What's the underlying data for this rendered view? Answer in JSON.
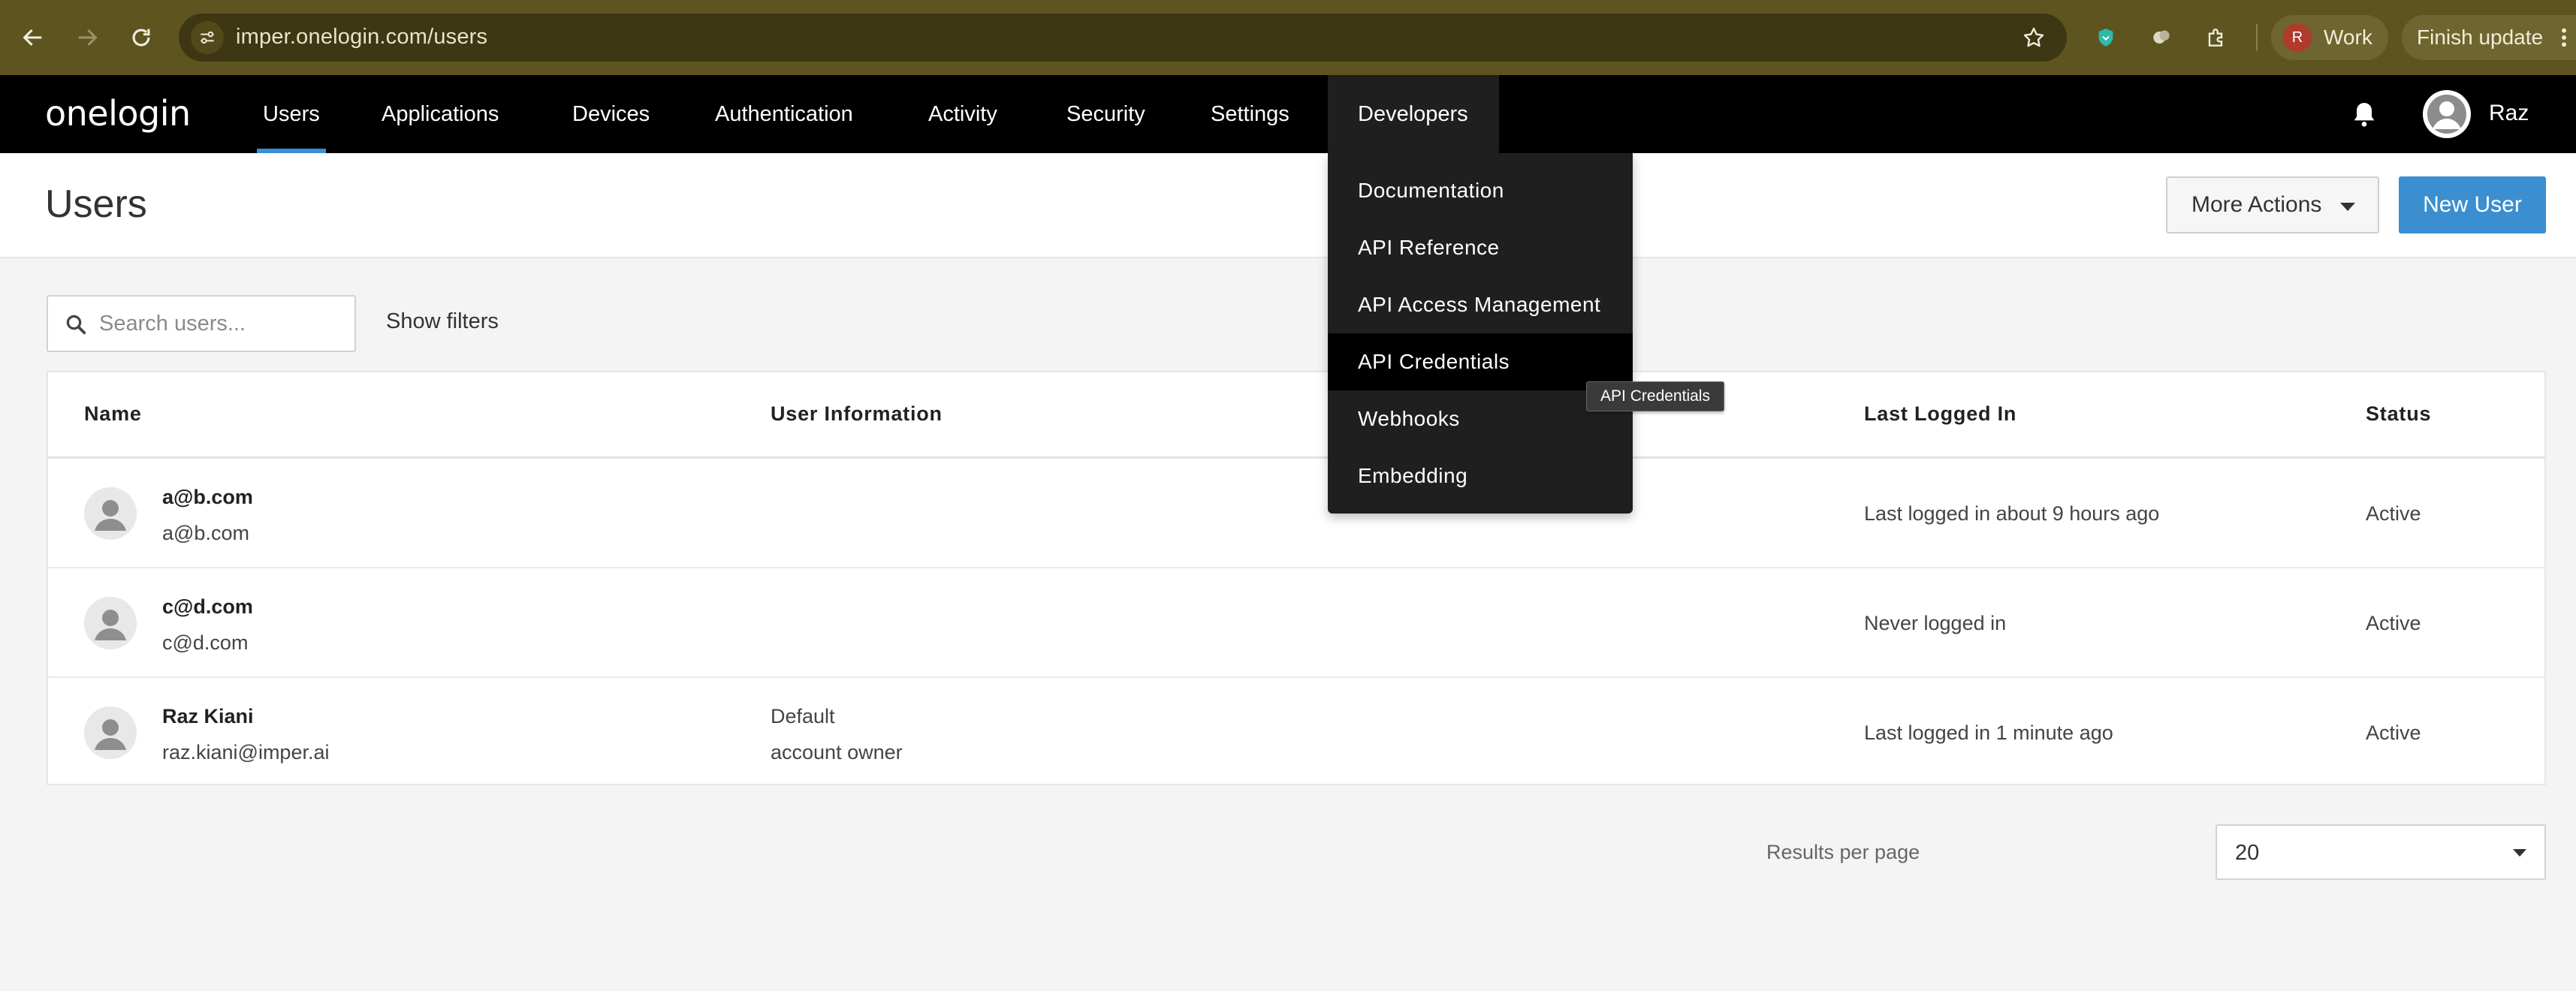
{
  "browser": {
    "url": "imper.onelogin.com/users",
    "profile_initial": "R",
    "profile_name": "Work",
    "finish_update": "Finish update"
  },
  "nav": {
    "logo": "onelogin",
    "items": [
      "Users",
      "Applications",
      "Devices",
      "Authentication",
      "Activity",
      "Security",
      "Settings",
      "Developers"
    ],
    "active": "Users",
    "user_name": "Raz"
  },
  "page": {
    "title": "Users",
    "more_actions": "More Actions",
    "new_user": "New User"
  },
  "search": {
    "placeholder": "Search users...",
    "show_filters": "Show filters"
  },
  "table": {
    "headers": [
      "Name",
      "User Information",
      "Last Logged In",
      "Status"
    ],
    "rows": [
      {
        "name": "a@b.com",
        "email": "a@b.com",
        "info1": "",
        "info2": "",
        "last_logged_in": "Last logged in about 9 hours ago",
        "status": "Active"
      },
      {
        "name": "c@d.com",
        "email": "c@d.com",
        "info1": "",
        "info2": "",
        "last_logged_in": "Never logged in",
        "status": "Active"
      },
      {
        "name": "Raz Kiani",
        "email": "raz.kiani@imper.ai",
        "info1": "Default",
        "info2": "account owner",
        "last_logged_in": "Last logged in 1 minute ago",
        "status": "Active"
      }
    ]
  },
  "pagination": {
    "results_per_page_label": "Results per page",
    "results_per_page_value": "20"
  },
  "developers_menu": {
    "items": [
      "Documentation",
      "API Reference",
      "API Access Management",
      "API Credentials",
      "Webhooks",
      "Embedding"
    ],
    "hovered": "API Credentials",
    "tooltip": "API Credentials"
  },
  "colors": {
    "chrome_bg": "#5d5420",
    "nav_bg": "#000000",
    "accent": "#3b8fd0",
    "menu_bg": "#1f1f1f"
  },
  "icons": [
    "back-icon",
    "forward-icon",
    "reload-icon",
    "site-info-icon",
    "star-icon",
    "extension-icon",
    "puzzle-icon",
    "bell-icon",
    "search-icon",
    "caret-down-icon",
    "kebab-icon"
  ]
}
